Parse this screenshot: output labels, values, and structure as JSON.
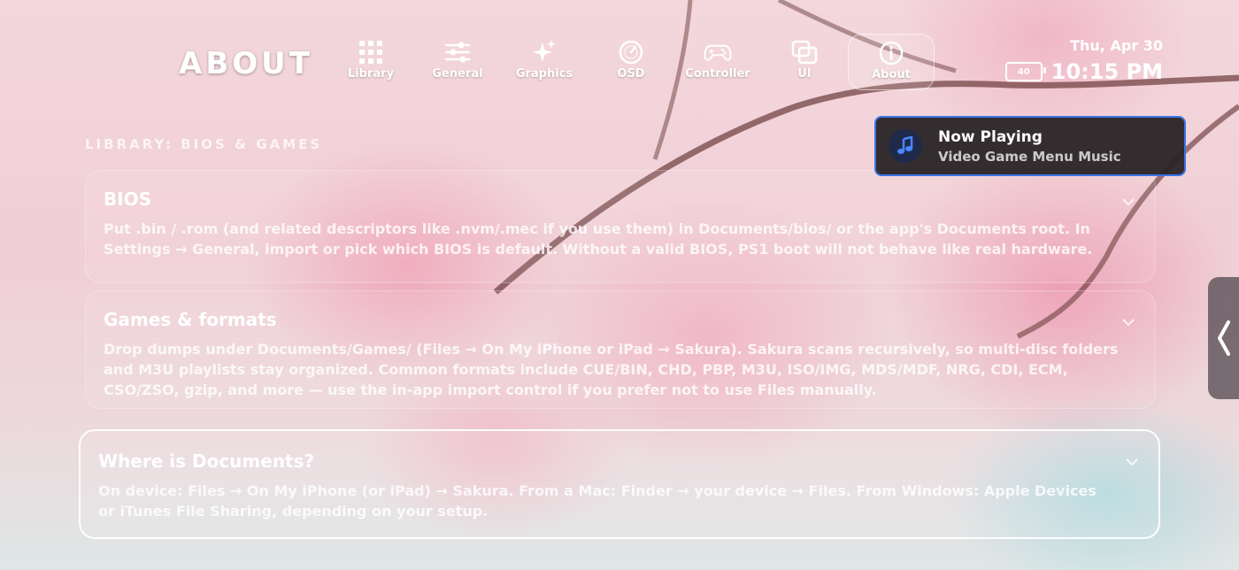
{
  "header": {
    "title": "ABOUT"
  },
  "nav": {
    "tabs": [
      {
        "label": "Library",
        "icon": "grid-icon",
        "active": false
      },
      {
        "label": "General",
        "icon": "sliders-icon",
        "active": false
      },
      {
        "label": "Graphics",
        "icon": "sparkles-icon",
        "active": false
      },
      {
        "label": "OSD",
        "icon": "gauge-icon",
        "active": false
      },
      {
        "label": "Controller",
        "icon": "gamepad-icon",
        "active": false
      },
      {
        "label": "UI",
        "icon": "windows-icon",
        "active": false
      },
      {
        "label": "About",
        "icon": "info-icon",
        "active": true
      }
    ]
  },
  "status": {
    "date": "Thu, Apr 30",
    "battery": "40",
    "time": "10:15 PM"
  },
  "section": {
    "heading": "LIBRARY: BIOS & GAMES"
  },
  "cards": [
    {
      "title": "BIOS",
      "body": "Put .bin / .rom (and related descriptors like .nvm/.mec if you use them) in Documents/bios/ or the app's Documents root. In Settings → General, import or pick which BIOS is default. Without a valid BIOS, PS1 boot will not behave like real hardware."
    },
    {
      "title": "Games & formats",
      "body": "Drop dumps under Documents/Games/ (Files → On My iPhone or iPad → Sakura). Sakura scans recursively, so multi-disc folders and M3U playlists stay organized. Common formats include CUE/BIN, CHD, PBP, M3U, ISO/IMG, MDS/MDF, NRG, CDI, ECM, CSO/ZSO, gzip, and more — use the in-app import control if you prefer not to use Files manually."
    },
    {
      "title": "Where is Documents?",
      "body": "On device: Files → On My iPhone (or iPad) → Sakura. From a Mac: Finder → your device → Files. From Windows: Apple Devices or iTunes File Sharing, depending on your setup."
    }
  ],
  "now_playing": {
    "title": "Now Playing",
    "track": "Video Game Menu Music",
    "icon": "music-note-icon"
  },
  "side_handle": {
    "icon": "chevron-left-icon"
  },
  "colors": {
    "accent": "#3a74e8",
    "toast_bg": "#282426"
  }
}
